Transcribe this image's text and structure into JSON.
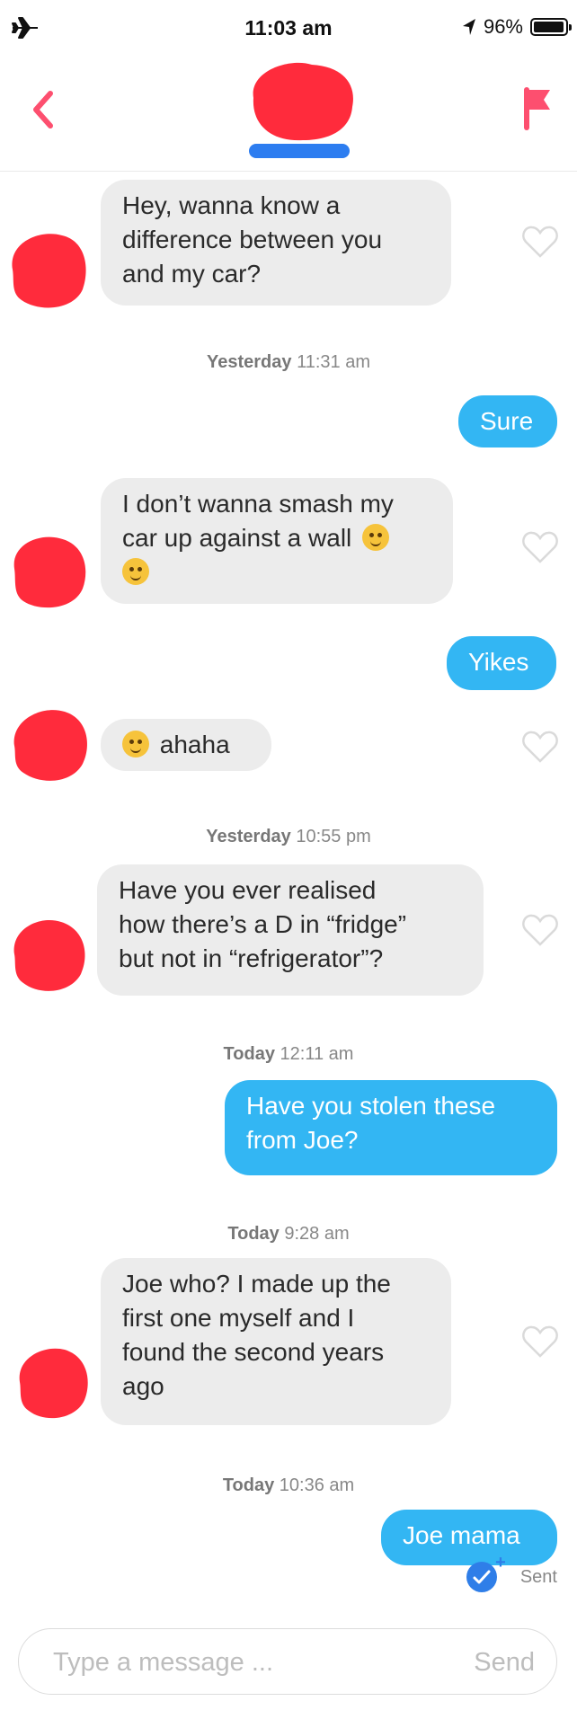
{
  "status_bar": {
    "time": "11:03 am",
    "battery_text": "96%",
    "battery_level": 0.96,
    "icons": [
      "airplane-icon",
      "location-arrow-icon",
      "battery-icon"
    ]
  },
  "header": {
    "icons": [
      "back-chevron-icon",
      "report-flag-icon"
    ],
    "accent_color": "#fd4f6f"
  },
  "messages": [
    {
      "type": "message",
      "direction": "incoming",
      "lines": [
        "Hey, wanna know a",
        "difference between you",
        "and my car?"
      ]
    },
    {
      "type": "timestamp",
      "day": "Yesterday",
      "time": "11:31 am"
    },
    {
      "type": "message",
      "direction": "outgoing",
      "text": "Sure"
    },
    {
      "type": "message",
      "direction": "incoming",
      "lines": [
        "I don’t wanna smash my",
        "car up against a wall"
      ],
      "emojis": [
        "smirking-face-emoji",
        "tears-of-joy-emoji"
      ]
    },
    {
      "type": "message",
      "direction": "outgoing",
      "text": "Yikes"
    },
    {
      "type": "message",
      "direction": "incoming",
      "text": "ahaha",
      "emojis": [
        "crying-face-emoji"
      ]
    },
    {
      "type": "timestamp",
      "day": "Yesterday",
      "time": "10:55 pm"
    },
    {
      "type": "message",
      "direction": "incoming",
      "lines": [
        "Have you ever realised",
        "how there’s a D in “fridge”",
        "but not in “refrigerator”?"
      ]
    },
    {
      "type": "timestamp",
      "day": "Today",
      "time": "12:11 am"
    },
    {
      "type": "message",
      "direction": "outgoing",
      "lines": [
        "Have you stolen these",
        "from Joe?"
      ]
    },
    {
      "type": "timestamp",
      "day": "Today",
      "time": "9:28 am"
    },
    {
      "type": "message",
      "direction": "incoming",
      "lines": [
        "Joe who? I made up the",
        "first one myself and I",
        "found the second years",
        "ago"
      ]
    },
    {
      "type": "timestamp",
      "day": "Today",
      "time": "10:36 am"
    },
    {
      "type": "message",
      "direction": "outgoing",
      "text": "Joe mama"
    }
  ],
  "delivery_status": "Sent",
  "composer": {
    "placeholder": "Type a message ...",
    "send_label": "Send"
  },
  "colors": {
    "outgoing_bubble": "#33b6f3",
    "incoming_bubble": "#ececec",
    "read_check": "#2f7ee8",
    "redaction": "#ff2b3c",
    "redaction_secondary": "#2d7df0"
  }
}
